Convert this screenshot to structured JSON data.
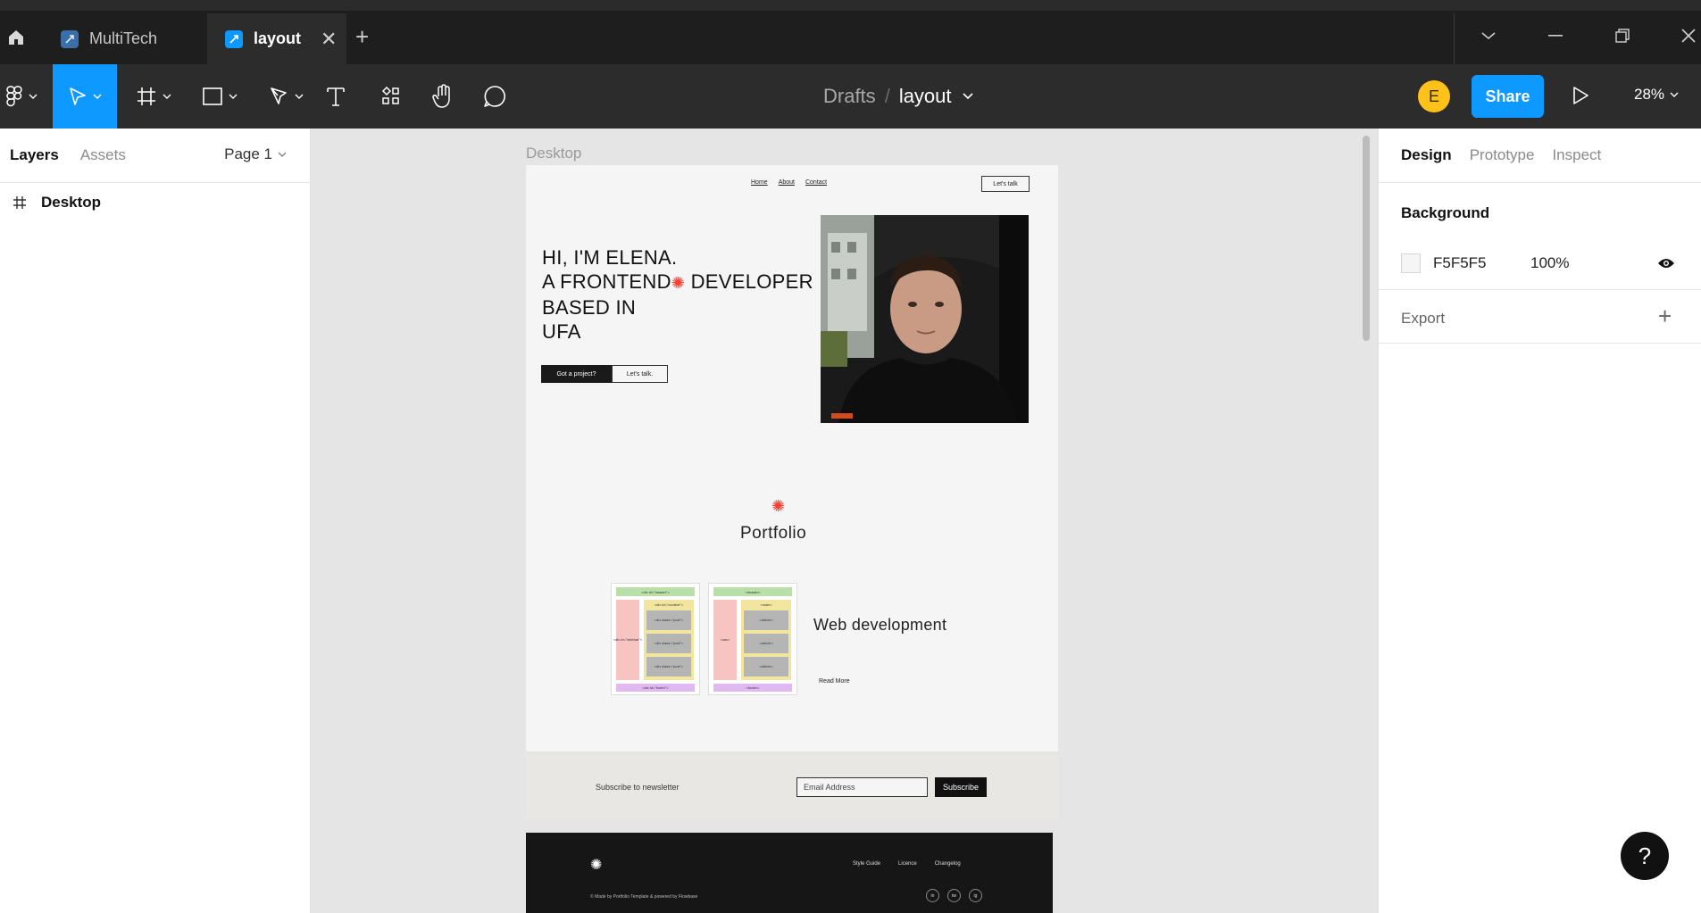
{
  "tabs": [
    {
      "label": "MultiTech",
      "active": false
    },
    {
      "label": "layout",
      "active": true
    }
  ],
  "toolbar": {
    "breadcrumb_root": "Drafts",
    "breadcrumb_sep": "/",
    "file_name": "layout",
    "avatar_initial": "E",
    "share_label": "Share",
    "zoom": "28%"
  },
  "left_panel": {
    "tab_layers": "Layers",
    "tab_assets": "Assets",
    "page": "Page 1",
    "layers": [
      {
        "name": "Desktop"
      }
    ]
  },
  "canvas": {
    "frame_label": "Desktop",
    "site": {
      "nav": [
        "Home",
        "About",
        "Contact"
      ],
      "nav_button": "Let's talk",
      "hero_line1": "HI, I'M ELENA.",
      "hero_line2a": "A FRONTEND",
      "hero_line2b": "DEVELOPER",
      "hero_line3": "BASED IN",
      "hero_line4": "UFA",
      "cta_dark": "Got a project?",
      "cta_light": "Let's talk.",
      "portfolio_title": "Portfolio",
      "project_title": "Web development",
      "read_more": "Read More",
      "thumb1": {
        "header": "<div id=\"header\">",
        "side": "<div id=\"sidebar\">",
        "content": "<div id=\"content\">",
        "post": "<div class=\"post\">",
        "footer": "<div id=\"footer\">"
      },
      "thumb2": {
        "header": "<header>",
        "side": "<nav>",
        "content": "<main>",
        "post": "<article>",
        "footer": "<footer>"
      },
      "newsletter_text": "Subscribe to newsletter",
      "newsletter_placeholder": "Email Address",
      "newsletter_button": "Subscribe",
      "footer_links": [
        "Style Guide",
        "Licence",
        "Changelog"
      ],
      "footer_copy": "© Made by Portfolio Template & powered by Flowbase",
      "footer_social": [
        "in",
        "tw",
        "ig"
      ]
    }
  },
  "right_panel": {
    "tabs": [
      "Design",
      "Prototype",
      "Inspect"
    ],
    "background_heading": "Background",
    "background_hex": "F5F5F5",
    "background_opacity": "100%",
    "export_label": "Export"
  },
  "colors": {
    "accent": "#0d99ff",
    "star": "#ff3d2e",
    "avatar": "#ffc21a"
  }
}
